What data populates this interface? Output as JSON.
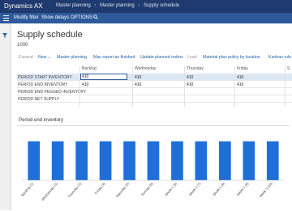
{
  "app": {
    "title": "Dynamics AX"
  },
  "breadcrumb": [
    "Master planning",
    "Master planning",
    "Supply schedule"
  ],
  "actionbar": {
    "items": [
      "Modify filter",
      "Show delays",
      "OPTIONS"
    ]
  },
  "page": {
    "title": "Supply schedule",
    "subtitle": "1000"
  },
  "toolbar": {
    "items": [
      "Expand",
      "New",
      "Master planning",
      "Mau report as finished",
      "Update planned orders",
      "Lead",
      "Material plan policy by location",
      "Kanban rule"
    ]
  },
  "grid": {
    "columns": [
      "Backlog",
      "Wednesday",
      "Thursday",
      "Friday",
      "S"
    ],
    "rows": [
      {
        "label": "PERIOD START INVENTORY",
        "values": [
          "410",
          "410",
          "410",
          "410"
        ]
      },
      {
        "label": "PERIOD END INVENTORY",
        "values": [
          "410",
          "410",
          "410",
          "410"
        ]
      },
      {
        "label": "PERIOD END PEGGED INVENTORY",
        "values": [
          "",
          "",
          "",
          ""
        ]
      },
      {
        "label": "PERIOD NET SUPPLY",
        "values": [
          "",
          "",
          "",
          ""
        ]
      }
    ]
  },
  "colors": {
    "titlebar": "#1f3a6e",
    "actionbar": "#2e5a9c",
    "bar": "#1e6fd9"
  },
  "chart_data": {
    "type": "bar",
    "title": "Period end inventory",
    "categories": [
      "Backlog (1)",
      "Wednesday (1)",
      "Thursday (1)",
      "Friday (4)",
      "Saturday (5)",
      "Sunday (6)",
      "Week 1 (6)",
      "Week 1 (7)",
      "Week 1 (8)",
      "Week 1 (9)",
      "Week 3 (10)"
    ],
    "values": [
      410,
      410,
      410,
      410,
      410,
      410,
      410,
      410,
      410,
      410,
      410
    ],
    "ylim": [
      0,
      500
    ],
    "grid": false
  }
}
